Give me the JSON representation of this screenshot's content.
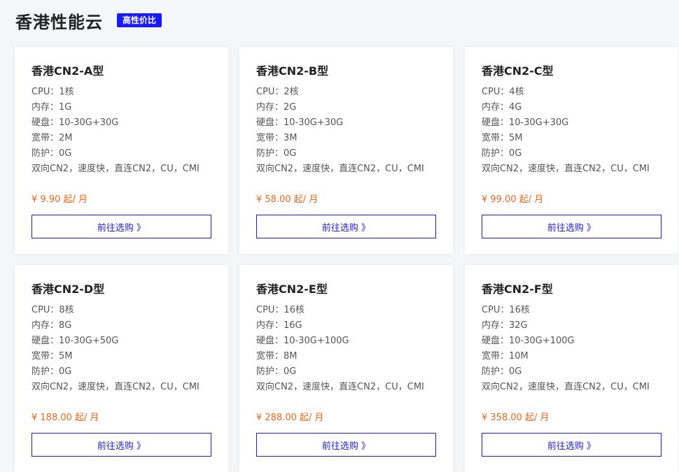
{
  "header": {
    "title": "香港性能云",
    "badge": "高性价比"
  },
  "accent_color": "#1a1aff",
  "price_color": "#e8671c",
  "button_label": "前往选购 》",
  "products": [
    {
      "name": "香港CN2-A型",
      "cpu": "CPU：1核",
      "memory": "内存：1G",
      "disk": "硬盘：10-30G+30G",
      "bandwidth": "宽带：2M",
      "protection": "防护：0G",
      "features": "双向CN2，速度快，直连CN2，CU，CMI",
      "price": "¥ 9.90 起/ 月"
    },
    {
      "name": "香港CN2-B型",
      "cpu": "CPU：2核",
      "memory": "内存：2G",
      "disk": "硬盘：10-30G+30G",
      "bandwidth": "宽带：3M",
      "protection": "防护：0G",
      "features": "双向CN2，速度快，直连CN2，CU，CMI",
      "price": "¥ 58.00 起/ 月"
    },
    {
      "name": "香港CN2-C型",
      "cpu": "CPU：4核",
      "memory": "内存：4G",
      "disk": "硬盘：10-30G+30G",
      "bandwidth": "宽带：5M",
      "protection": "防护：0G",
      "features": "双向CN2，速度快，直连CN2，CU，CMI",
      "price": "¥ 99.00 起/ 月"
    },
    {
      "name": "香港CN2-D型",
      "cpu": "CPU：8核",
      "memory": "内存：8G",
      "disk": "硬盘：10-30G+50G",
      "bandwidth": "宽带：5M",
      "protection": "防护：0G",
      "features": "双向CN2，速度快，直连CN2，CU，CMI",
      "price": "¥ 188.00 起/ 月"
    },
    {
      "name": "香港CN2-E型",
      "cpu": "CPU：16核",
      "memory": "内存：16G",
      "disk": "硬盘：10-30G+100G",
      "bandwidth": "宽带：8M",
      "protection": "防护：0G",
      "features": "双向CN2，速度快，直连CN2，CU，CMI",
      "price": "¥ 288.00 起/ 月"
    },
    {
      "name": "香港CN2-F型",
      "cpu": "CPU：16核",
      "memory": "内存：32G",
      "disk": "硬盘：10-30G+100G",
      "bandwidth": "宽带：10M",
      "protection": "防护：0G",
      "features": "双向CN2，速度快，直连CN2，CU，CMI",
      "price": "¥ 358.00 起/ 月"
    }
  ]
}
